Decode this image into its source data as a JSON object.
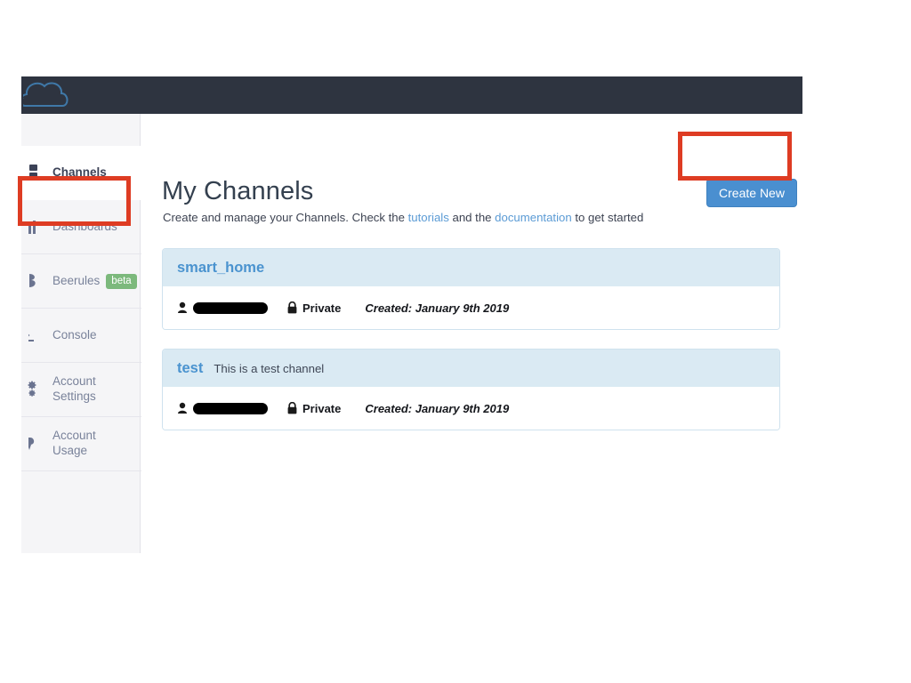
{
  "navbar": {
    "logo_icon": "cloud-icon"
  },
  "sidebar": {
    "items": [
      {
        "label": "Channels",
        "icon": "channels-icon",
        "active": true,
        "badge": null
      },
      {
        "label": "Dashboards",
        "icon": "bar-chart-icon",
        "active": false,
        "badge": null
      },
      {
        "label": "Beerules",
        "icon": "beerules-icon",
        "active": false,
        "badge": "beta"
      },
      {
        "label": "Console",
        "icon": "terminal-icon",
        "active": false,
        "badge": null
      },
      {
        "label": "Account\nSettings",
        "icon": "gear-icon",
        "active": false,
        "badge": null
      },
      {
        "label": "Account\nUsage",
        "icon": "gauge-icon",
        "active": false,
        "badge": null
      }
    ]
  },
  "main": {
    "title": "My Channels",
    "subtitle": {
      "part1": "Create and manage your Channels. Check the ",
      "link1": "tutorials",
      "part2": " and the ",
      "link2": "documentation",
      "part3": " to get started"
    },
    "create_button": "Create New",
    "channels": [
      {
        "name": "smart_home",
        "description": "",
        "owner_redacted": true,
        "owner_bar_width": 84,
        "visibility": "Private",
        "created": "Created: January 9th 2019"
      },
      {
        "name": "test",
        "description": "This is a test channel",
        "owner_redacted": true,
        "owner_bar_width": 84,
        "visibility": "Private",
        "created": "Created: January 9th 2019"
      }
    ]
  },
  "annotations": {
    "color": "#de3c23",
    "boxes": [
      "create-new-button",
      "sidebar-item-channels"
    ]
  }
}
